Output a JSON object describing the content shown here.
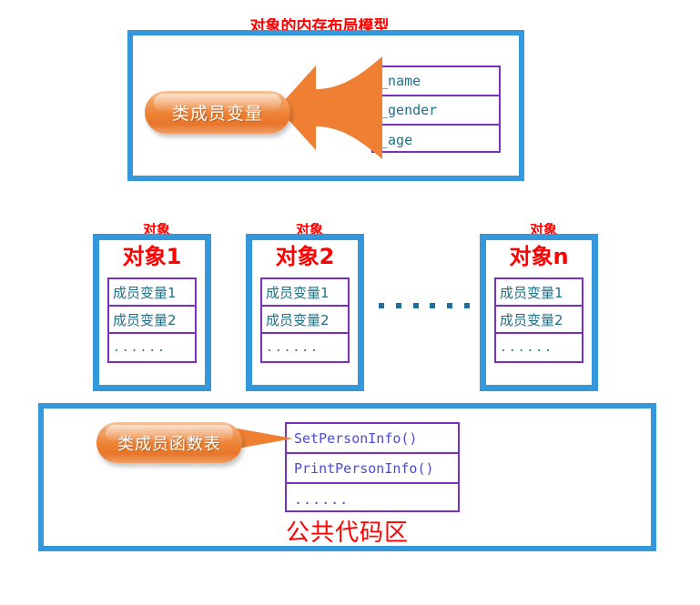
{
  "diagram": {
    "title_clipped": "对象的内存布局模型",
    "colors": {
      "frame_blue": "#3498db",
      "table_purple": "#7b2fbe",
      "callout_orange": "#ee8133",
      "title_red": "#ff0000",
      "code_text_teal": "#1f6f86",
      "func_text_blue": "#4b4bd4"
    }
  },
  "top_section": {
    "clipped_caption": "对象的内存布局模型",
    "callout_label": "类成员变量",
    "arrow_icon": "left-arrow-icon",
    "attributes": [
      "_name",
      "_gender",
      "_age"
    ]
  },
  "objects_section": {
    "clipped_caption": "对象",
    "separator": "......",
    "separator_dot_count": 6,
    "boxes": [
      {
        "title": "对象1",
        "rows": [
          "成员变量1",
          "成员变量2",
          "......"
        ]
      },
      {
        "title": "对象2",
        "rows": [
          "成员变量1",
          "成员变量2",
          "......"
        ]
      },
      {
        "title": "对象n",
        "rows": [
          "成员变量1",
          "成员变量2",
          "......"
        ]
      }
    ]
  },
  "bottom_section": {
    "callout_label": "类成员函数表",
    "connector_icon": "pointer-connector-icon",
    "functions": [
      "SetPersonInfo()",
      "PrintPersonInfo()",
      "......"
    ],
    "footer_label": "公共代码区"
  }
}
